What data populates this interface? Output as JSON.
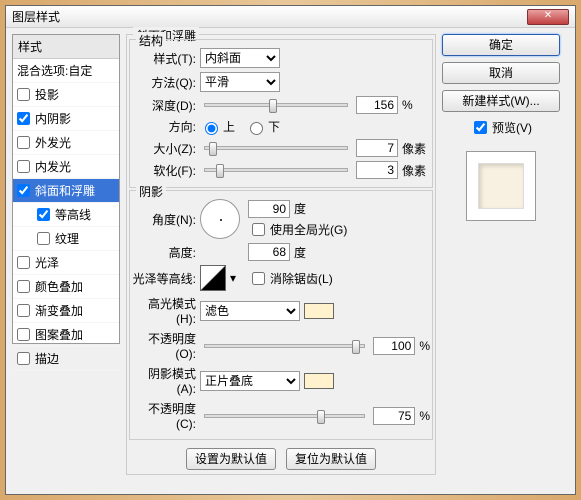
{
  "title": "图层样式",
  "left": {
    "header": "样式",
    "blend_header": "混合选项:自定",
    "items": [
      {
        "label": "投影",
        "checked": false,
        "sel": false
      },
      {
        "label": "内阴影",
        "checked": true,
        "sel": false
      },
      {
        "label": "外发光",
        "checked": false,
        "sel": false
      },
      {
        "label": "内发光",
        "checked": false,
        "sel": false
      },
      {
        "label": "斜面和浮雕",
        "checked": true,
        "sel": true
      },
      {
        "label": "等高线",
        "checked": true,
        "sel": false,
        "sub": true
      },
      {
        "label": "纹理",
        "checked": false,
        "sel": false,
        "sub": true
      },
      {
        "label": "光泽",
        "checked": false,
        "sel": false
      },
      {
        "label": "颜色叠加",
        "checked": false,
        "sel": false
      },
      {
        "label": "渐变叠加",
        "checked": false,
        "sel": false
      },
      {
        "label": "图案叠加",
        "checked": false,
        "sel": false
      },
      {
        "label": "描边",
        "checked": false,
        "sel": false
      }
    ]
  },
  "bevel": {
    "group_title": "斜面和浮雕",
    "structure_title": "结构",
    "style_lbl": "样式(T):",
    "style_val": "内斜面",
    "method_lbl": "方法(Q):",
    "method_val": "平滑",
    "depth_lbl": "深度(D):",
    "depth_val": "156",
    "pct": "%",
    "dir_lbl": "方向:",
    "up": "上",
    "down": "下",
    "size_lbl": "大小(Z):",
    "size_val": "7",
    "px": "像素",
    "soften_lbl": "软化(F):",
    "soften_val": "3",
    "shadow_title": "阴影",
    "angle_lbl": "角度(N):",
    "angle_val": "90",
    "deg": "度",
    "global_lbl": "使用全局光(G)",
    "alt_lbl": "高度:",
    "alt_val": "68",
    "gloss_lbl": "光泽等高线:",
    "antialias_lbl": "消除锯齿(L)",
    "hmode_lbl": "高光模式(H):",
    "hmode_val": "滤色",
    "opac_lbl": "不透明度(O):",
    "hopac_val": "100",
    "smode_lbl": "阴影模式(A):",
    "smode_val": "正片叠底",
    "sopac_lbl": "不透明度(C):",
    "sopac_val": "75",
    "set_default": "设置为默认值",
    "reset_default": "复位为默认值"
  },
  "right": {
    "ok": "确定",
    "cancel": "取消",
    "new_style": "新建样式(W)...",
    "preview": "预览(V)"
  },
  "colors": {
    "highlight": "#fff2cc",
    "shadow": "#fff2cc"
  }
}
